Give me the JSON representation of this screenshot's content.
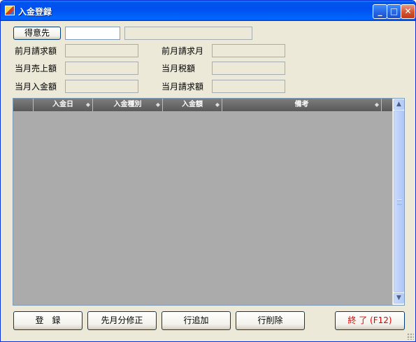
{
  "window": {
    "title": "入金登録"
  },
  "title_buttons": {
    "minimize": "_",
    "maximize": "□",
    "close": "✕"
  },
  "customer": {
    "button_label": "得意先",
    "code_value": "",
    "name_value": ""
  },
  "fields": {
    "prev_billing_amount_label": "前月請求額",
    "prev_billing_month_label": "前月請求月",
    "current_sales_label": "当月売上額",
    "current_tax_label": "当月税額",
    "current_payment_label": "当月入金額",
    "current_billing_label": "当月請求額"
  },
  "grid": {
    "columns": [
      "",
      "入金日",
      "入金種別",
      "入金額",
      "備考"
    ],
    "sort_glyph": "◆",
    "scroll_up": "▲",
    "scroll_down": "▼",
    "rows": []
  },
  "buttons": {
    "register": "登　録",
    "prev_month_fix": "先月分修正",
    "add_row": "行追加",
    "delete_row": "行削除",
    "close": "終 了 (F12)"
  },
  "colors": {
    "close_button_text": "#E00000",
    "grid_background": "#ABABAB",
    "header_background": "#6A6A6A"
  }
}
